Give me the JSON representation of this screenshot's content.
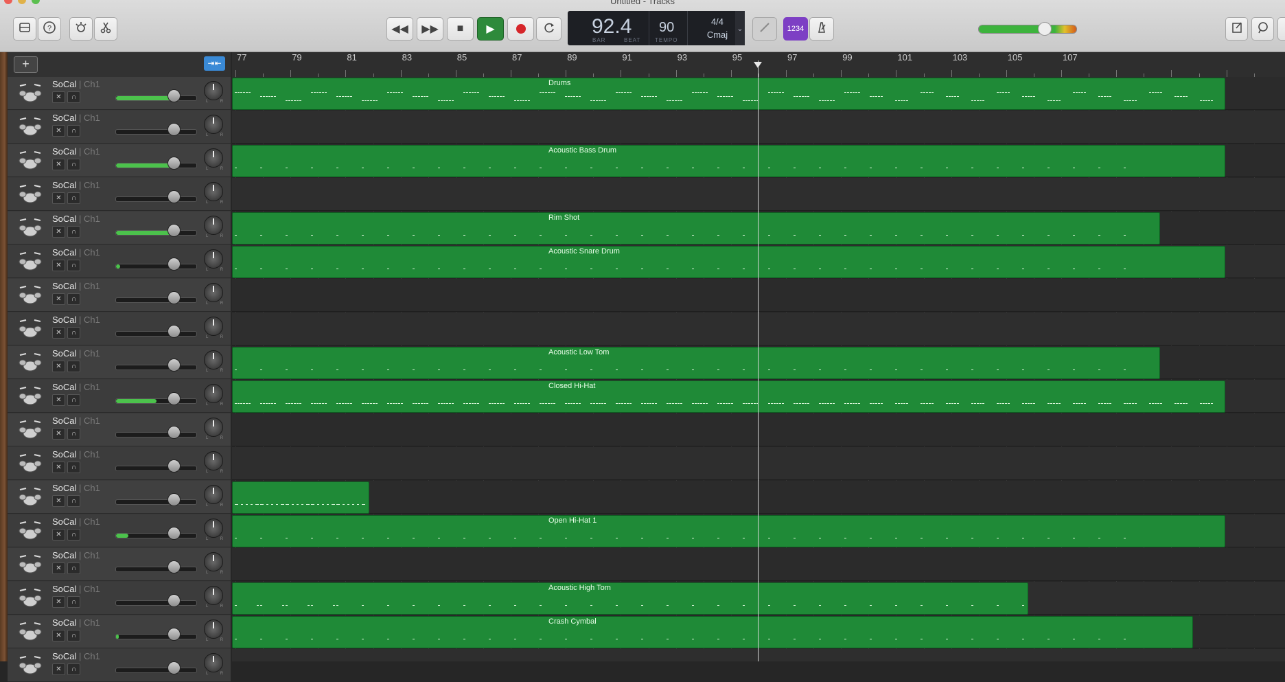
{
  "window": {
    "title": "Untitled - Tracks"
  },
  "lcd": {
    "position": "92.4",
    "bar_label": "BAR",
    "beat_label": "BEAT",
    "tempo": "90",
    "tempo_label": "TEMPO",
    "time_signature": "4/4",
    "key": "Cmaj"
  },
  "controls": {
    "count_in": "1234"
  },
  "header": {
    "add_label": "+"
  },
  "ruler": {
    "bars": [
      "77",
      "79",
      "81",
      "83",
      "85",
      "87",
      "89",
      "91",
      "93",
      "95",
      "97",
      "99",
      "101",
      "103",
      "105",
      "107"
    ]
  },
  "colors": {
    "region_fill": "#1f8a37",
    "count_in": "#7d3fc4",
    "volume_fill": "#4cc24c"
  },
  "tracks": [
    {
      "name": "SoCal",
      "channel": "Ch1",
      "sep": " | ",
      "volume": 0.72,
      "meter": 0.72,
      "region": "Drums"
    },
    {
      "name": "SoCal",
      "channel": "Ch1",
      "sep": " | ",
      "volume": 0.72,
      "meter": 0,
      "region": ""
    },
    {
      "name": "SoCal",
      "channel": "Ch1",
      "sep": " | ",
      "volume": 0.72,
      "meter": 0.72,
      "region": "Acoustic Bass Drum"
    },
    {
      "name": "SoCal",
      "channel": "Ch1",
      "sep": " | ",
      "volume": 0.72,
      "meter": 0,
      "region": ""
    },
    {
      "name": "SoCal",
      "channel": "Ch1",
      "sep": " | ",
      "volume": 0.72,
      "meter": 0.72,
      "region": "Rim Shot"
    },
    {
      "name": "SoCal",
      "channel": "Ch1",
      "sep": " | ",
      "volume": 0.72,
      "meter": 0.05,
      "region": "Acoustic Snare Drum"
    },
    {
      "name": "SoCal",
      "channel": "Ch1",
      "sep": " | ",
      "volume": 0.72,
      "meter": 0,
      "region": ""
    },
    {
      "name": "SoCal",
      "channel": "Ch1",
      "sep": " | ",
      "volume": 0.72,
      "meter": 0,
      "region": ""
    },
    {
      "name": "SoCal",
      "channel": "Ch1",
      "sep": " | ",
      "volume": 0.72,
      "meter": 0,
      "region": "Acoustic Low Tom"
    },
    {
      "name": "SoCal",
      "channel": "Ch1",
      "sep": " | ",
      "volume": 0.72,
      "meter": 0.5,
      "region": "Closed Hi-Hat"
    },
    {
      "name": "SoCal",
      "channel": "Ch1",
      "sep": " | ",
      "volume": 0.72,
      "meter": 0,
      "region": ""
    },
    {
      "name": "SoCal",
      "channel": "Ch1",
      "sep": " | ",
      "volume": 0.72,
      "meter": 0,
      "region": ""
    },
    {
      "name": "SoCal",
      "channel": "Ch1",
      "sep": " | ",
      "volume": 0.72,
      "meter": 0,
      "region": ""
    },
    {
      "name": "SoCal",
      "channel": "Ch1",
      "sep": " | ",
      "volume": 0.72,
      "meter": 0.15,
      "region": "Open Hi-Hat 1"
    },
    {
      "name": "SoCal",
      "channel": "Ch1",
      "sep": " | ",
      "volume": 0.72,
      "meter": 0,
      "region": ""
    },
    {
      "name": "SoCal",
      "channel": "Ch1",
      "sep": " | ",
      "volume": 0.72,
      "meter": 0,
      "region": "Acoustic High Tom"
    },
    {
      "name": "SoCal",
      "channel": "Ch1",
      "sep": " | ",
      "volume": 0.72,
      "meter": 0.03,
      "region": "Crash Cymbal"
    },
    {
      "name": "SoCal",
      "channel": "Ch1",
      "sep": " | ",
      "volume": 0.72,
      "meter": 0,
      "region": ""
    }
  ]
}
